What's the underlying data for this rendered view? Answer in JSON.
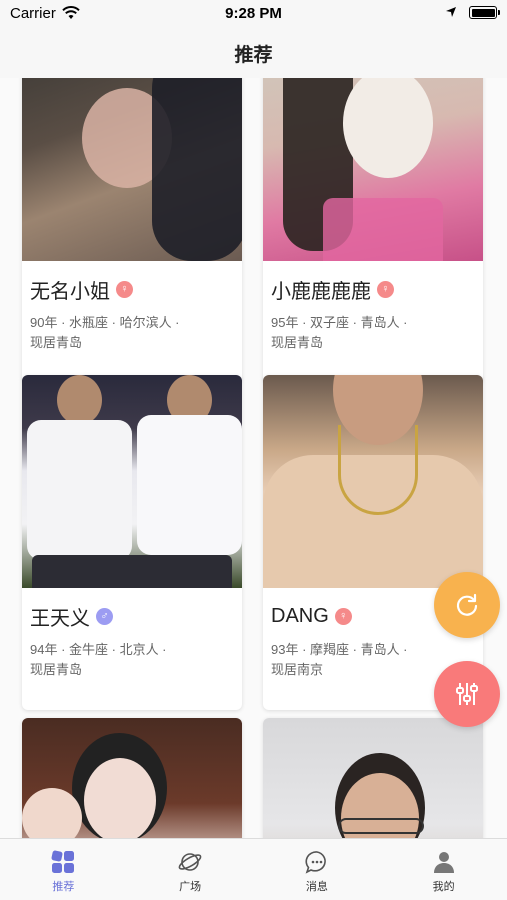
{
  "status_bar": {
    "carrier": "Carrier",
    "time": "9:28 PM"
  },
  "nav": {
    "title": "推荐"
  },
  "cards": [
    {
      "name": "无名小姐",
      "gender": "female",
      "gender_symbol": "♀",
      "details_line1": "90年 · 水瓶座 · 哈尔滨人 ·",
      "details_line2": "现居青岛"
    },
    {
      "name": "小鹿鹿鹿鹿",
      "gender": "female",
      "gender_symbol": "♀",
      "details_line1": "95年 · 双子座 · 青岛人 ·",
      "details_line2": "现居青岛"
    },
    {
      "name": "王天义",
      "gender": "male",
      "gender_symbol": "♂",
      "details_line1": "94年 · 金牛座 · 北京人 ·",
      "details_line2": "现居青岛"
    },
    {
      "name": "DANG",
      "gender": "female",
      "gender_symbol": "♀",
      "details_line1": "93年 · 摩羯座 · 青岛人 ·",
      "details_line2": "现居南京"
    }
  ],
  "tabs": [
    {
      "label": "推荐",
      "icon": "grid-icon",
      "active": true
    },
    {
      "label": "广场",
      "icon": "planet-icon",
      "active": false
    },
    {
      "label": "消息",
      "icon": "chat-bubble-icon",
      "active": false
    },
    {
      "label": "我的",
      "icon": "person-icon",
      "active": false
    }
  ],
  "colors": {
    "accent": "#6a72d8",
    "female_badge": "#f58a8a",
    "male_badge": "#9c9cf2",
    "refresh_button": "#f8b24e",
    "filter_button": "#f97a7a"
  }
}
